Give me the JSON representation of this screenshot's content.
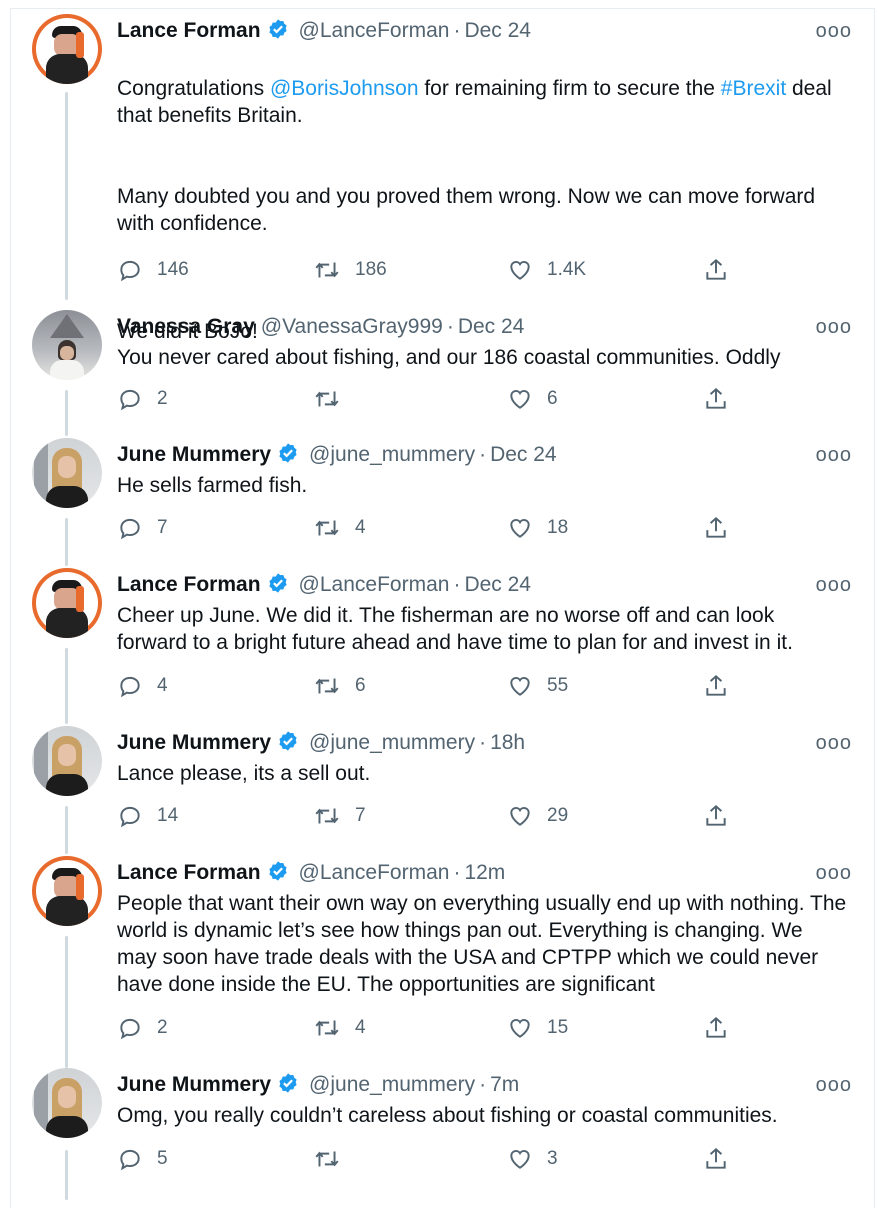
{
  "tweets": [
    {
      "author": "Lance Forman",
      "handle": "@LanceForman",
      "time": "Dec 24",
      "verified": true,
      "avatar": "lance",
      "text_parts": [
        "Congratulations ",
        "@BorisJohnson",
        " for remaining firm to secure the ",
        "#Brexit",
        " deal that benefits Britain."
      ],
      "text_para2": "Many doubted you and you proved them wrong. Now we can move forward with confidence.",
      "text_para3": "We did it BoJo!",
      "replies": "146",
      "retweets": "186",
      "likes": "1.4K"
    },
    {
      "author": "Vanessa Gray",
      "handle": "@VanessaGray999",
      "time": "Dec 24",
      "verified": false,
      "avatar": "vanessa",
      "text": "You never cared about fishing, and our 186 coastal communities. Oddly",
      "replies": "2",
      "retweets": "",
      "likes": "6"
    },
    {
      "author": "June Mummery",
      "handle": "@june_mummery",
      "time": "Dec 24",
      "verified": true,
      "avatar": "june",
      "text": "He sells farmed fish.",
      "replies": "7",
      "retweets": "4",
      "likes": "18"
    },
    {
      "author": "Lance Forman",
      "handle": "@LanceForman",
      "time": "Dec 24",
      "verified": true,
      "avatar": "lance",
      "text": "Cheer up June. We did it. The fisherman are no worse off and can look forward to a bright future ahead and have time to plan for and invest in it.",
      "replies": "4",
      "retweets": "6",
      "likes": "55"
    },
    {
      "author": "June Mummery",
      "handle": "@june_mummery",
      "time": "18h",
      "verified": true,
      "avatar": "june",
      "text": "Lance please, its a sell out.",
      "replies": "14",
      "retweets": "7",
      "likes": "29"
    },
    {
      "author": "Lance Forman",
      "handle": "@LanceForman",
      "time": "12m",
      "verified": true,
      "avatar": "lance",
      "text": "People that want their own way on everything usually end up with nothing. The world is dynamic let’s see how things pan out. Everything is changing. We may soon have trade deals with the USA and CPTPP which we could never have done inside the EU. The opportunities are significant",
      "replies": "2",
      "retweets": "4",
      "likes": "15"
    },
    {
      "author": "June Mummery",
      "handle": "@june_mummery",
      "time": "7m",
      "verified": true,
      "avatar": "june",
      "text": "Omg, you really couldn’t careless about fishing or coastal communities.",
      "replies": "5",
      "retweets": "",
      "likes": "3"
    }
  ],
  "ui": {
    "separator": "·",
    "more_glyph": "ooo"
  },
  "colors": {
    "link": "#1d9bf0",
    "verified": "#1d9bf0",
    "muted": "#536471",
    "thread_line": "#cfd9de"
  },
  "icons": {
    "reply": "reply-icon",
    "retweet": "retweet-icon",
    "like": "heart-icon",
    "share": "share-icon",
    "verified": "verified-badge-icon",
    "more": "more-options-icon"
  }
}
